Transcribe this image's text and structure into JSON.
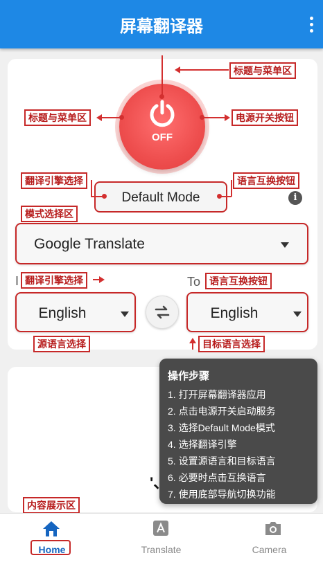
{
  "header": {
    "title": "屏幕翻译器"
  },
  "power": {
    "label": "OFF"
  },
  "mode": {
    "label": "Default Mode"
  },
  "engine": {
    "value": "Google Translate"
  },
  "languages": {
    "from_caption": "I",
    "to_caption": "To",
    "source": "English",
    "target": "English"
  },
  "annotations": {
    "title_menu_top": "标题与菜单区",
    "title_menu_left": "标题与菜单区",
    "power_switch": "电源开关按钮",
    "engine_select_top": "翻译引擎选择",
    "lang_swap_top": "语言互换按钮",
    "mode_select": "模式选择区",
    "engine_select_mid": "翻译引擎选择",
    "lang_swap_mid": "语言互换按钮",
    "source_lang": "源语言选择",
    "target_lang": "目标语言选择",
    "content_area": "内容展示区"
  },
  "steps": {
    "title": "操作步骤",
    "items": [
      "1. 打开屏幕翻译器应用",
      "2. 点击电源开关启动服务",
      "3. 选择Default Mode模式",
      "4. 选择翻译引擎",
      "5. 设置源语言和目标语言",
      "6. 必要时点击互换语言",
      "7. 使用底部导航切换功能"
    ]
  },
  "content": {
    "fragment": "'、"
  },
  "nav": {
    "items": [
      {
        "label": "Home",
        "icon": "home-icon"
      },
      {
        "label": "Translate",
        "icon": "translate-icon"
      },
      {
        "label": "Camera",
        "icon": "camera-icon"
      }
    ]
  },
  "colors": {
    "primary": "#1e88e5",
    "power": "#ef5350",
    "annotation": "#c62828"
  }
}
